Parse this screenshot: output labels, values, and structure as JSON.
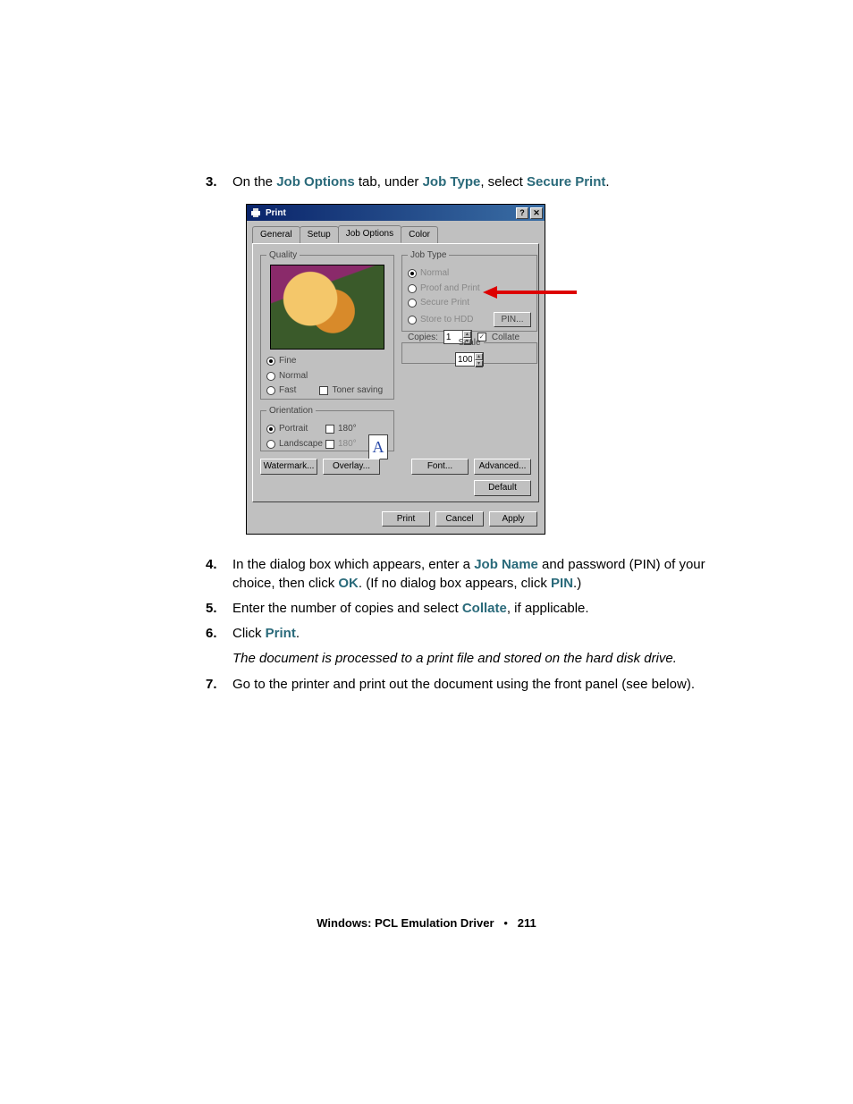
{
  "steps": {
    "s3": {
      "num": "3.",
      "pre": "On the ",
      "link1": "Job Options",
      "mid": " tab, under ",
      "link2": "Job Type",
      "mid2": ", select ",
      "link3": "Secure Print",
      "post": "."
    },
    "s4": {
      "num": "4.",
      "pre": "In the dialog box which appears, enter a ",
      "link1": "Job Name",
      "mid": " and password (PIN) of your choice, then click ",
      "link2": "OK",
      "mid2": ". (If no dialog box appears, click ",
      "link3": "PIN",
      "post": ".)"
    },
    "s5": {
      "num": "5.",
      "pre": "Enter the number of copies and select ",
      "link1": "Collate",
      "post": ", if applicable."
    },
    "s6": {
      "num": "6.",
      "pre": "Click ",
      "link1": "Print",
      "post": ".",
      "note": "The document is processed to a print file and stored on the hard disk drive."
    },
    "s7": {
      "num": "7.",
      "text": "Go to the printer and print out the document using the front panel (see below)."
    }
  },
  "dialog": {
    "title": "Print",
    "help_glyph": "?",
    "close_glyph": "✕",
    "tabs": {
      "general": "General",
      "setup": "Setup",
      "job_options": "Job Options",
      "color": "Color"
    },
    "quality": {
      "legend": "Quality",
      "fine": "Fine",
      "normal": "Normal",
      "fast": "Fast",
      "toner_saving": "Toner saving"
    },
    "orientation": {
      "legend": "Orientation",
      "portrait": "Portrait",
      "landscape": "Landscape",
      "rot1": "180°",
      "rot2": "180°",
      "letter": "A"
    },
    "jobtype": {
      "legend": "Job Type",
      "normal": "Normal",
      "proof": "Proof and Print",
      "secure": "Secure Print",
      "store": "Store to HDD",
      "pin": "PIN...",
      "copies_label": "Copies:",
      "copies_value": "1",
      "collate": "Collate"
    },
    "scale": {
      "legend": "Scale",
      "value": "100"
    },
    "buttons": {
      "watermark": "Watermark...",
      "overlay": "Overlay...",
      "font": "Font...",
      "advanced": "Advanced...",
      "default": "Default",
      "print": "Print",
      "cancel": "Cancel",
      "apply": "Apply"
    }
  },
  "footer": {
    "title": "Windows: PCL Emulation Driver",
    "sep": "•",
    "page": "211"
  }
}
